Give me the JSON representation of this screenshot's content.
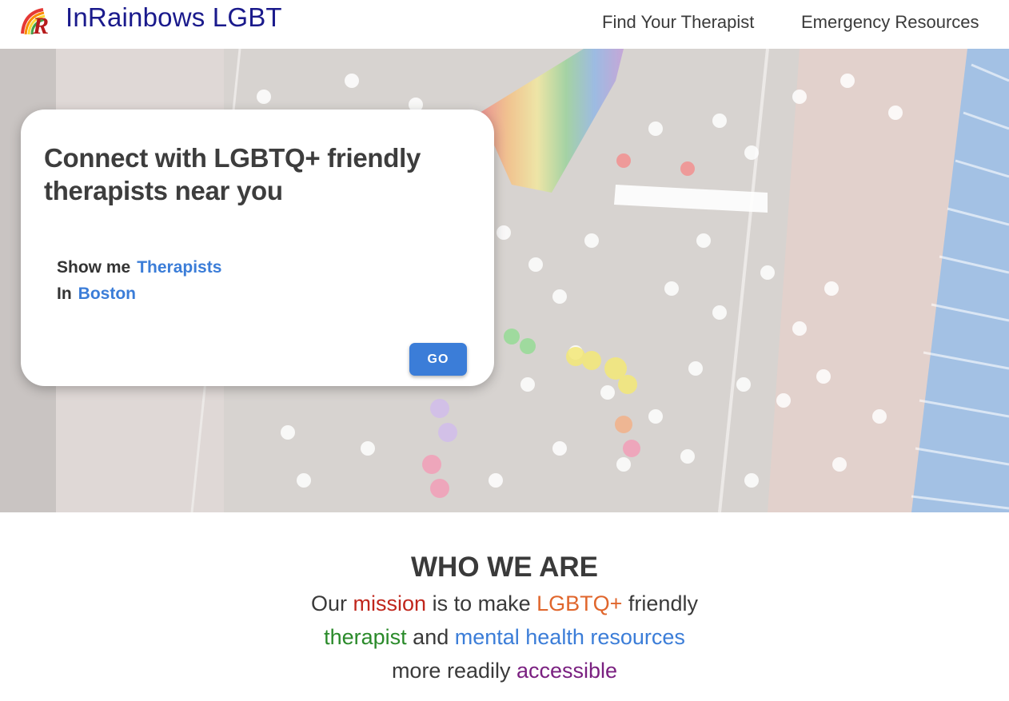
{
  "header": {
    "brand": "InRainbows LGBT",
    "nav": {
      "find_therapist": "Find Your Therapist",
      "emergency_resources": "Emergency Resources"
    },
    "logo_letter": "R"
  },
  "hero": {
    "card": {
      "title": "Connect with LGBTQ+ friendly therapists near you",
      "show_me_label": "Show me",
      "show_me_value": "Therapists",
      "in_label": "In",
      "in_value": "Boston",
      "go_label": "GO"
    }
  },
  "who_we_are": {
    "title": "WHO WE ARE",
    "mission_parts": {
      "p1": "Our ",
      "p2": "mission",
      "p3": " is to make ",
      "p4": "LGBTQ+",
      "p5": " friendly ",
      "p6": "therapist",
      "p7": " and ",
      "p8": "mental health resources",
      "p9": " more readily ",
      "p10": "accessible"
    }
  },
  "colors": {
    "brand": "#1a1a8c",
    "accent_blue": "#3b7dd8",
    "mission_red": "#c0261c",
    "mission_orange": "#e0662c",
    "mission_green": "#2a8a2a",
    "mission_purple": "#7a2080"
  }
}
